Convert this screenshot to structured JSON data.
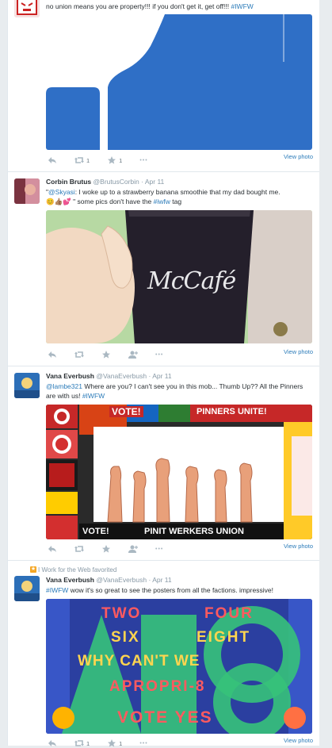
{
  "tweets": [
    {
      "text_prefix": "no union means you are property!!! if you don't get it, get off!!! ",
      "hashtag": "#IWFW",
      "view_photo": "View photo",
      "retweets": "1",
      "favorites": "1",
      "more": "•••"
    },
    {
      "fullname": "Corbin Brutus",
      "handle": "@BrutusCorbin",
      "dot": "·",
      "time": "Apr 11",
      "quote_open": "\"",
      "mention": "@Skyasi",
      "text_1": ": I woke up to a strawberry banana smoothie that my dad bought me.",
      "emoji": "😊👍🏽💕",
      "text_2": "\" some pics don't have the ",
      "hashtag": "#iwfw",
      "text_3": " tag",
      "media_text": "McCafé",
      "view_photo": "View photo"
    },
    {
      "fullname": "Vana Everbush",
      "handle": "@VanaEverbush",
      "dot": "·",
      "time": "Apr 11",
      "mention": "@lambe321",
      "text_1": " Where are you? I can't see you in this mob... Thumb Up?? All the Pinners are with us! ",
      "hashtag": "#IWFW",
      "poster_top": "VOTE!",
      "poster_top_right": "PINNERS UNITE!",
      "poster_bottom_left": "VOTE!",
      "poster_bottom": "PINIT WERKERS UNION",
      "view_photo": "View photo"
    },
    {
      "context": "I Work for the Web favorited",
      "fullname": "Vana Everbush",
      "handle": "@VanaEverbush",
      "dot": "·",
      "time": "Apr 11",
      "hashtag": "#IWFW",
      "text_1": " wow it's so great to see the posters from all the factions. impressive!",
      "poster_line1a": "TWO",
      "poster_line1b": "FOUR",
      "poster_line2a": "SIX",
      "poster_line2b": "EIGHT",
      "poster_line3": "WHY CAN'T WE",
      "poster_line4": "APROPRI-8",
      "poster_line5": "VOTE YES",
      "view_photo": "View photo",
      "retweets": "1",
      "favorites": "1"
    }
  ],
  "colors": {
    "link": "#2b7bb9",
    "facebook_blue": "#2f6fc6",
    "icon_grey": "#aab8c2",
    "favorite_badge": "#f5a623"
  }
}
